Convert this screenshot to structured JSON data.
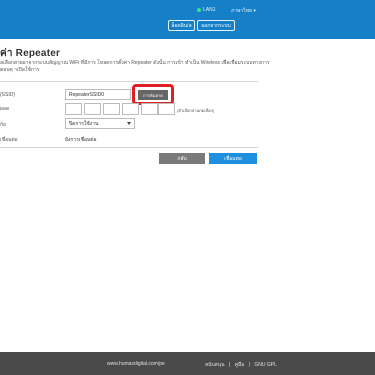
{
  "topbar": {
    "lan_status": "LAN1",
    "language": "ภาษาไทย ▾",
    "login_button": "ล็อคอิน/ล",
    "exit_button": "ออกจากระบบ"
  },
  "page": {
    "title": "ค่า Repeater",
    "description": "ลเลือกสายอาจากระบบสัญญาณ WiFi ที่มีการ โหลดการตั้งค่า Repeater ดังนั้น การเข้า ทำเป็น Wireless เพื่อเชื่อมระบบทางการตอบคุ\nาเปิดใช้การ"
  },
  "form": {
    "ssid_label": "(SSID)",
    "ssid_value": "RepeaterSSID0",
    "scan_button": "การค้นหาด",
    "password_label": "ผลด",
    "password_hint": "(ตัวเลือกลานกดเลือก)",
    "security_label": "กัย",
    "security_value": "ปิดการใช้งาน",
    "connection_label": "เชื่อมต่อ",
    "connection_value": "ยังการเชื่อมต่อ"
  },
  "actions": {
    "back_button": "กลับ",
    "connect_button": "เชื่อมต่อ"
  },
  "footer": {
    "url": "www.humaxdigital.com/pe",
    "links": [
      "สนับสนุน",
      "คู่มือ",
      "GNU GPL"
    ],
    "separator": "|"
  },
  "colors": {
    "topbar": "#1580c8",
    "scan_highlight": "#e02020",
    "connect_button": "#1e8fde",
    "footer": "#4a4a4a"
  }
}
